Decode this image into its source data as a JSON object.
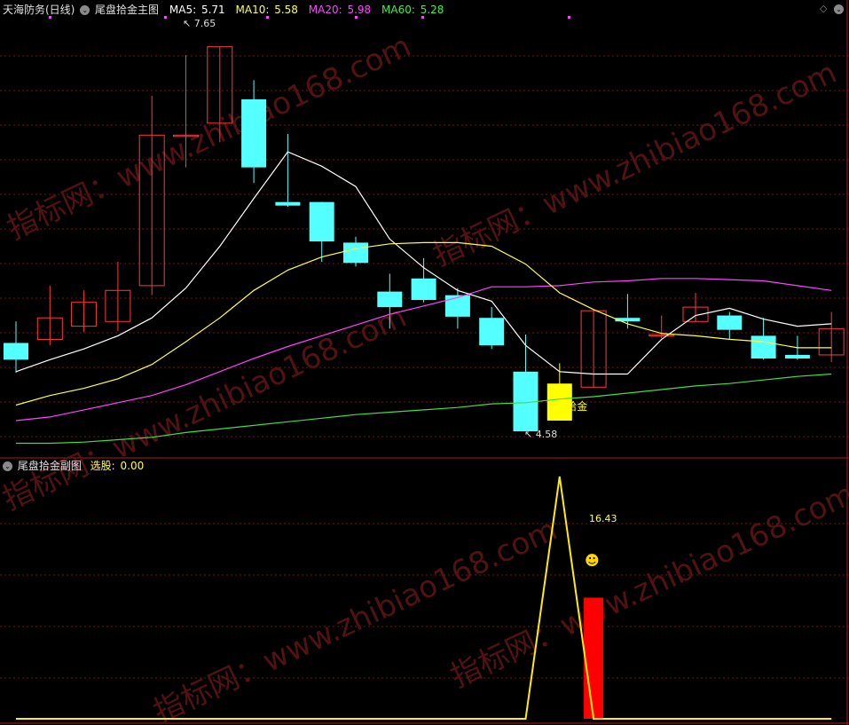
{
  "main_header": {
    "stock": "天海防务(日线)",
    "indicator": "尾盘拾金主图",
    "ma5_label": "MA5:",
    "ma5_value": "5.71",
    "ma10_label": "MA10:",
    "ma10_value": "5.58",
    "ma20_label": "MA20:",
    "ma20_value": "5.98",
    "ma60_label": "MA60:",
    "ma60_value": "5.28"
  },
  "sub_header": {
    "indicator": "尾盘拾金副图",
    "xuangu_label": "选股:",
    "xuangu_value": "0.00"
  },
  "annotations": {
    "high": "7.65",
    "low": "4.58",
    "signal": "▲拾金",
    "sub_value": "16.43",
    "smiley": "☻"
  },
  "watermark": "指标网：www.zhibiao168.com",
  "icons": {
    "diamond": "diamond-icon",
    "toggle": "collapse-circle-icon"
  },
  "colors": {
    "up": "#ff3a3a",
    "down": "#54ffff",
    "signal": "#ffff00",
    "ma5": "#ffffff",
    "ma10": "#ffff44",
    "ma20": "#ff44ff",
    "ma60": "#44dd44",
    "sub_bar": "#ff0000",
    "sub_line": "#ffee00"
  },
  "chart_data": [
    {
      "type": "candlestick",
      "ylim": [
        4.3,
        8.0
      ],
      "candles": [
        {
          "o": 5.24,
          "c": 5.1,
          "h": 5.42,
          "l": 4.99
        },
        {
          "o": 5.27,
          "c": 5.45,
          "h": 5.72,
          "l": 5.22
        },
        {
          "o": 5.38,
          "c": 5.58,
          "h": 5.68,
          "l": 5.33
        },
        {
          "o": 5.42,
          "c": 5.68,
          "h": 5.92,
          "l": 5.34
        },
        {
          "o": 5.72,
          "c": 6.98,
          "h": 7.31,
          "l": 5.64
        },
        {
          "o": 6.98,
          "c": 6.98,
          "h": 7.65,
          "l": 6.71
        },
        {
          "o": 7.08,
          "c": 7.72,
          "h": 7.72,
          "l": 6.92
        },
        {
          "o": 7.28,
          "c": 6.71,
          "h": 7.44,
          "l": 6.58
        },
        {
          "o": 6.42,
          "c": 6.39,
          "h": 6.99,
          "l": 6.38
        },
        {
          "o": 6.42,
          "c": 6.09,
          "h": 6.42,
          "l": 5.92
        },
        {
          "o": 6.08,
          "c": 5.91,
          "h": 6.13,
          "l": 5.88
        },
        {
          "o": 5.67,
          "c": 5.54,
          "h": 5.82,
          "l": 5.36
        },
        {
          "o": 5.78,
          "c": 5.6,
          "h": 5.95,
          "l": 5.58
        },
        {
          "o": 5.64,
          "c": 5.46,
          "h": 5.7,
          "l": 5.36
        },
        {
          "o": 5.45,
          "c": 5.22,
          "h": 5.54,
          "l": 5.19
        },
        {
          "o": 5.0,
          "c": 4.5,
          "h": 5.31,
          "l": 4.58
        },
        {
          "o": 4.9,
          "c": 4.59,
          "h": 5.07,
          "l": 4.59
        },
        {
          "o": 4.87,
          "c": 5.51,
          "h": 5.52,
          "l": 4.87
        },
        {
          "o": 5.45,
          "c": 5.42,
          "h": 5.65,
          "l": 5.36
        },
        {
          "o": 5.3,
          "c": 5.31,
          "h": 5.47,
          "l": 5.28
        },
        {
          "o": 5.42,
          "c": 5.54,
          "h": 5.66,
          "l": 5.42
        },
        {
          "o": 5.47,
          "c": 5.35,
          "h": 5.5,
          "l": 5.27
        },
        {
          "o": 5.3,
          "c": 5.11,
          "h": 5.45,
          "l": 5.1
        },
        {
          "o": 5.14,
          "c": 5.11,
          "h": 5.3,
          "l": 5.1
        },
        {
          "o": 5.14,
          "c": 5.36,
          "h": 5.5,
          "l": 5.08
        }
      ],
      "ma5": [
        5.0,
        5.1,
        5.19,
        5.3,
        5.45,
        5.7,
        6.05,
        6.45,
        6.84,
        6.72,
        6.55,
        6.11,
        5.87,
        5.68,
        5.59,
        5.22,
        5.0,
        4.98,
        4.98,
        5.27,
        5.47,
        5.53,
        5.44,
        5.38,
        5.4
      ],
      "ma10": [
        4.72,
        4.8,
        4.86,
        4.94,
        5.06,
        5.25,
        5.45,
        5.68,
        5.85,
        5.96,
        6.03,
        6.07,
        6.08,
        6.08,
        6.05,
        5.9,
        5.66,
        5.52,
        5.4,
        5.32,
        5.3,
        5.27,
        5.25,
        5.2,
        5.2
      ],
      "ma20": [
        4.59,
        4.62,
        4.68,
        4.74,
        4.8,
        4.89,
        5.0,
        5.11,
        5.21,
        5.3,
        5.39,
        5.48,
        5.55,
        5.62,
        5.71,
        5.71,
        5.72,
        5.75,
        5.76,
        5.78,
        5.78,
        5.77,
        5.76,
        5.72,
        5.68
      ],
      "ma60": [
        4.4,
        4.4,
        4.41,
        4.43,
        4.45,
        4.49,
        4.52,
        4.55,
        4.58,
        4.61,
        4.64,
        4.66,
        4.68,
        4.7,
        4.73,
        4.74,
        4.77,
        4.79,
        4.82,
        4.85,
        4.88,
        4.9,
        4.93,
        4.96,
        4.98
      ]
    },
    {
      "type": "line",
      "ylim": [
        0,
        20
      ],
      "series": [
        {
          "values": [
            0,
            0,
            0,
            0,
            0,
            0,
            0,
            0,
            0,
            0,
            0,
            0,
            0,
            0,
            0,
            0,
            20,
            0,
            0,
            0,
            0,
            0,
            0,
            0,
            0
          ]
        }
      ],
      "bars": [
        {
          "index": 17,
          "value": 10
        }
      ]
    }
  ]
}
